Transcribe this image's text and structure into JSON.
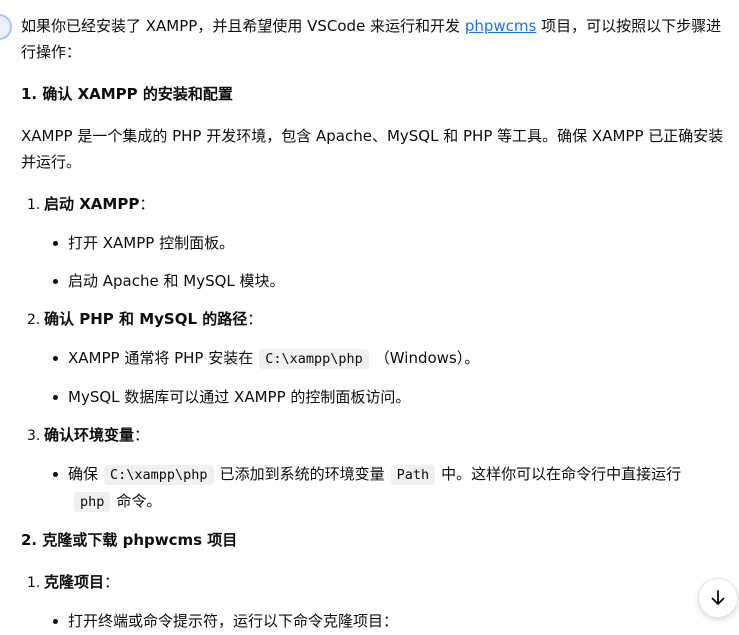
{
  "intro": {
    "pre": "如果你已经安装了 XAMPP，并且希望使用 VSCode 来运行和开发 ",
    "link": "phpwcms",
    "post": " 项目，可以按照以下步骤进行操作："
  },
  "section1": {
    "heading": "1. 确认 XAMPP 的安装和配置",
    "para": "XAMPP 是一个集成的 PHP 开发环境，包含 Apache、MySQL 和 PHP 等工具。确保 XAMPP 已正确安装并运行。",
    "steps": [
      {
        "num": "1.",
        "label": "启动 XAMPP",
        "colon": "：",
        "bullets": [
          "打开 XAMPP 控制面板。",
          "启动 Apache 和 MySQL 模块。"
        ]
      },
      {
        "num": "2.",
        "label": "确认 PHP 和 MySQL 的路径",
        "colon": "：",
        "b1_pre": "XAMPP 通常将 PHP 安装在",
        "b1_code": "C:\\xampp\\php",
        "b1_post": "（Windows）。",
        "b2": "MySQL 数据库可以通过 XAMPP 的控制面板访问。"
      },
      {
        "num": "3.",
        "label": "确认环境变量",
        "colon": "：",
        "b1_pre": "确保",
        "b1_code1": "C:\\xampp\\php",
        "b1_mid": "已添加到系统的环境变量",
        "b1_code2": "Path",
        "b1_mid2": "中。这样你可以在命令行中直接运行",
        "b1_code3": "php",
        "b1_post": "命令。"
      }
    ]
  },
  "section2": {
    "heading": "2. 克隆或下载 phpwcms 项目",
    "steps": [
      {
        "num": "1.",
        "label": "克隆项目",
        "colon": "：",
        "bullets": [
          "打开终端或命令提示符，运行以下命令克隆项目："
        ]
      }
    ]
  },
  "scroll_button": {
    "icon": "arrow-down-icon"
  }
}
